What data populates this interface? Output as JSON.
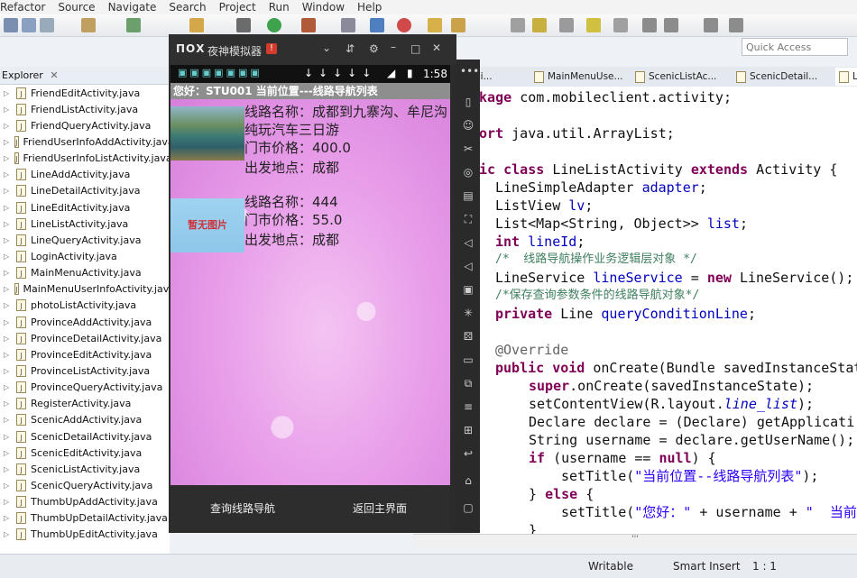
{
  "menu": [
    "Refactor",
    "Source",
    "Navigate",
    "Search",
    "Project",
    "Run",
    "Window",
    "Help"
  ],
  "quick_access": "Quick Access",
  "explorer": {
    "title": "Explorer",
    "files": [
      "FriendEditActivity.java",
      "FriendListActivity.java",
      "FriendQueryActivity.java",
      "FriendUserInfoAddActivity.java",
      "FriendUserInfoListActivity.java",
      "LineAddActivity.java",
      "LineDetailActivity.java",
      "LineEditActivity.java",
      "LineListActivity.java",
      "LineQueryActivity.java",
      "LoginActivity.java",
      "MainMenuActivity.java",
      "MainMenuUserInfoActivity.java",
      "photoListActivity.java",
      "ProvinceAddActivity.java",
      "ProvinceDetailActivity.java",
      "ProvinceEditActivity.java",
      "ProvinceListActivity.java",
      "ProvinceQueryActivity.java",
      "RegisterActivity.java",
      "ScenicAddActivity.java",
      "ScenicDetailActivity.java",
      "ScenicEditActivity.java",
      "ScenicListActivity.java",
      "ScenicQueryActivity.java",
      "ThumbUpAddActivity.java",
      "ThumbUpDetailActivity.java",
      "ThumbUpEditActivity.java"
    ]
  },
  "editor_tabs": [
    "gi...",
    "MainMenuUse...",
    "ScenicListAc...",
    "ScenicDetail...",
    "Li"
  ],
  "code": {
    "l1a": "ckage ",
    "l1b": "com.mobileclient.activity;",
    "l2a": "port ",
    "l2b": "java.util.ArrayList;",
    "l3a": "lic class ",
    "l3b": "LineListActivity ",
    "l3c": "extends ",
    "l3d": "Activity {",
    "l4a": "LineSimpleAdapter ",
    "l4b": "adapter",
    "l4c": ";",
    "l5a": "ListView ",
    "l5b": "lv",
    "l5c": ";",
    "l6a": "List<Map<String, Object>> ",
    "l6b": "list",
    "l6c": ";",
    "l7a": "int ",
    "l7b": "lineId",
    "l7c": ";",
    "l8": "/*  线路导航操作业务逻辑层对象 */",
    "l9a": "LineService ",
    "l9b": "lineService",
    "l9c": " = ",
    "l9d": "new ",
    "l9e": "LineService();",
    "l10": "/*保存查询参数条件的线路导航对象*/",
    "l11a": "private ",
    "l11b": "Line ",
    "l11c": "queryConditionLine",
    "l11d": ";",
    "l12": "@Override",
    "l13a": "public void ",
    "l13b": "onCreate(Bundle savedInstanceStat",
    "l14a": "super",
    "l14b": ".onCreate(savedInstanceState);",
    "l15a": "setContentView(R.layout.",
    "l15b": "line_list",
    "l15c": ");",
    "l16": "Declare declare = (Declare) getApplicati",
    "l17": "String username = declare.getUserName();",
    "l18a": "if ",
    "l18b": "(username == ",
    "l18c": "null",
    "l18d": ") {",
    "l19a": "setTitle(",
    "l19b": "\"当前位置--线路导航列表\"",
    "l19c": ");",
    "l20a": "} ",
    "l20b": "else ",
    "l20c": "{",
    "l21a": "setTitle(",
    "l21b": "\"您好：\"",
    "l21c": " + username + ",
    "l21d": "\"  当前",
    "l22": "}"
  },
  "emulator": {
    "title": "夜神模拟器",
    "badge": "!",
    "time": "1:58",
    "app_title": "您好：STU001  当前位置---线路导航列表",
    "items": [
      {
        "name_line": "线路名称：成都到九寨沟、牟尼沟纯玩汽车三日游",
        "price_line": "门市价格：400.0",
        "place_line": "出发地点：成都",
        "image_label": ""
      },
      {
        "name_line": "线路名称：444",
        "price_line": "门市价格：55.0",
        "place_line": "出发地点：成都",
        "image_label": "暂无图片"
      }
    ],
    "buttons": {
      "query": "查询线路导航",
      "back": "返回主界面"
    }
  },
  "status": {
    "writable": "Writable",
    "insert": "Smart Insert",
    "position": "1 : 1"
  },
  "hscroll_grip": "'''"
}
